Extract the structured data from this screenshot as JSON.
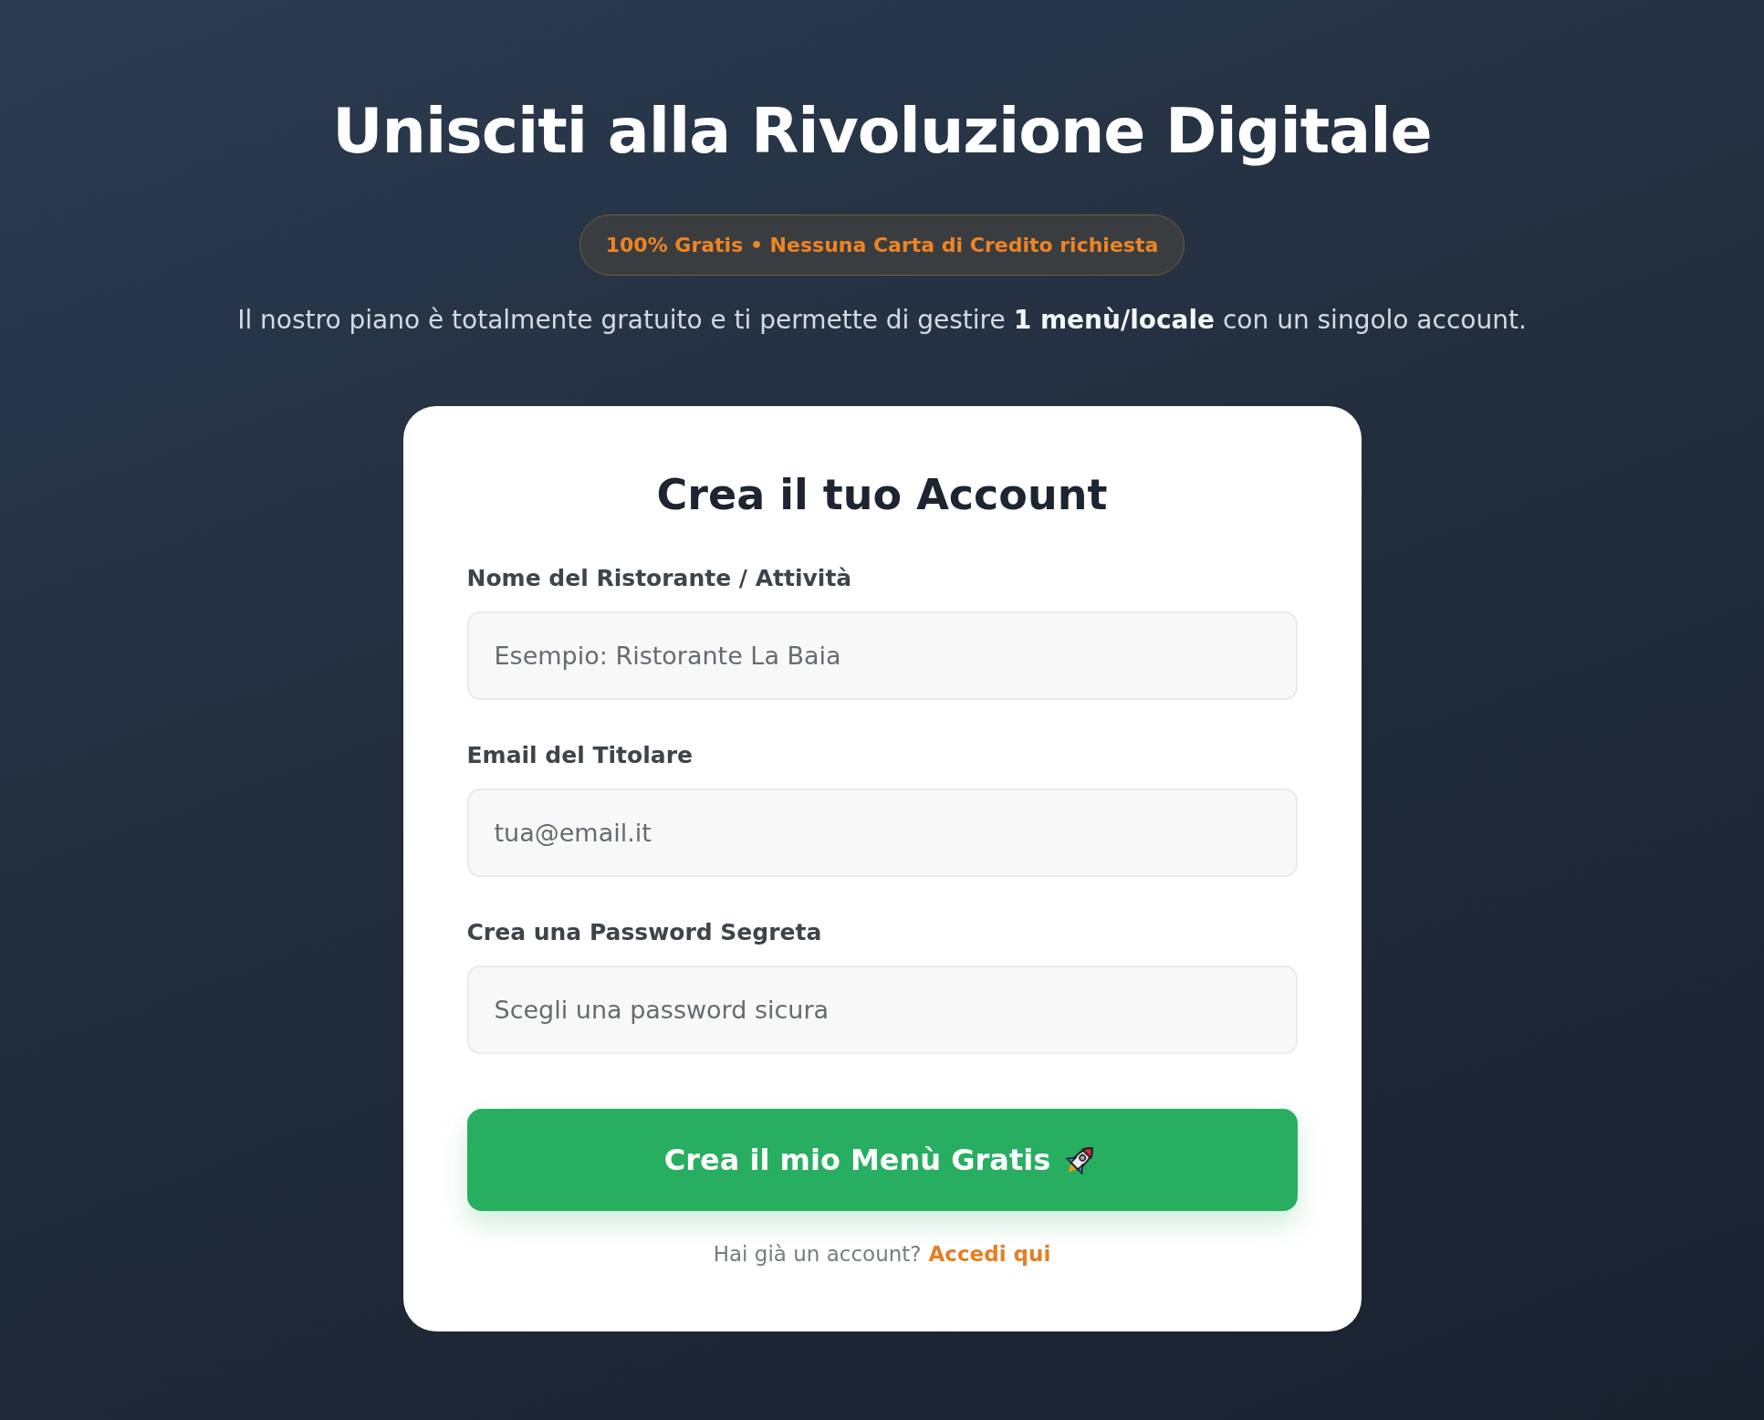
{
  "heading": "Unisciti alla Rivoluzione Digitale",
  "badge": "100% Gratis • Nessuna Carta di Credito richiesta",
  "intro": "Il nostro piano è totalmente gratuito e ti permette di gestire **1 menù/locale** con un singolo account.",
  "card": {
    "title": "Crea il tuo Account",
    "fields": [
      {
        "label": "Nome del Ristorante / Attività",
        "placeholder": "Esempio: Ristorante La Baia"
      },
      {
        "label": "Email del Titolare",
        "placeholder": "tua@email.it"
      },
      {
        "label": "Crea una Password Segreta",
        "placeholder": "Scegli una password sicura"
      }
    ],
    "submit": "Crea il mio Menù Gratis",
    "login_prompt": "Hai già un account?",
    "login_link": "Accedi qui"
  }
}
